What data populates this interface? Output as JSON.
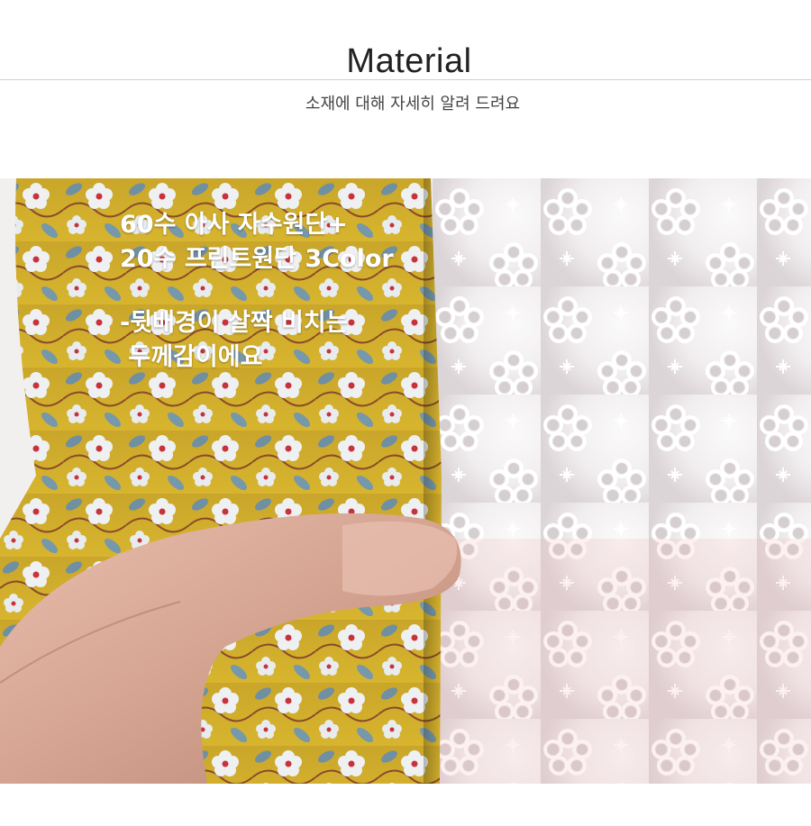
{
  "header": {
    "title": "Material",
    "subtitle": "소재에 대해 자세히 알려 드려요"
  },
  "photo": {
    "alt": "",
    "overlay_lines": [
      "60수 아사 자수원단+",
      "20수 프린트원단 3Color",
      "-뒷배경이 살짝 비치는",
      " 두께감이에요"
    ]
  },
  "colors": {
    "yellow_print": "#d9b42c",
    "flower_blue": "#7a9bb0",
    "flower_white": "#eef0f2",
    "flower_red": "#c8323b",
    "eyelet_white": "#f4f2f3",
    "eyelet_shadow": "#d8cfd2",
    "skin": "#d9aa9a"
  }
}
